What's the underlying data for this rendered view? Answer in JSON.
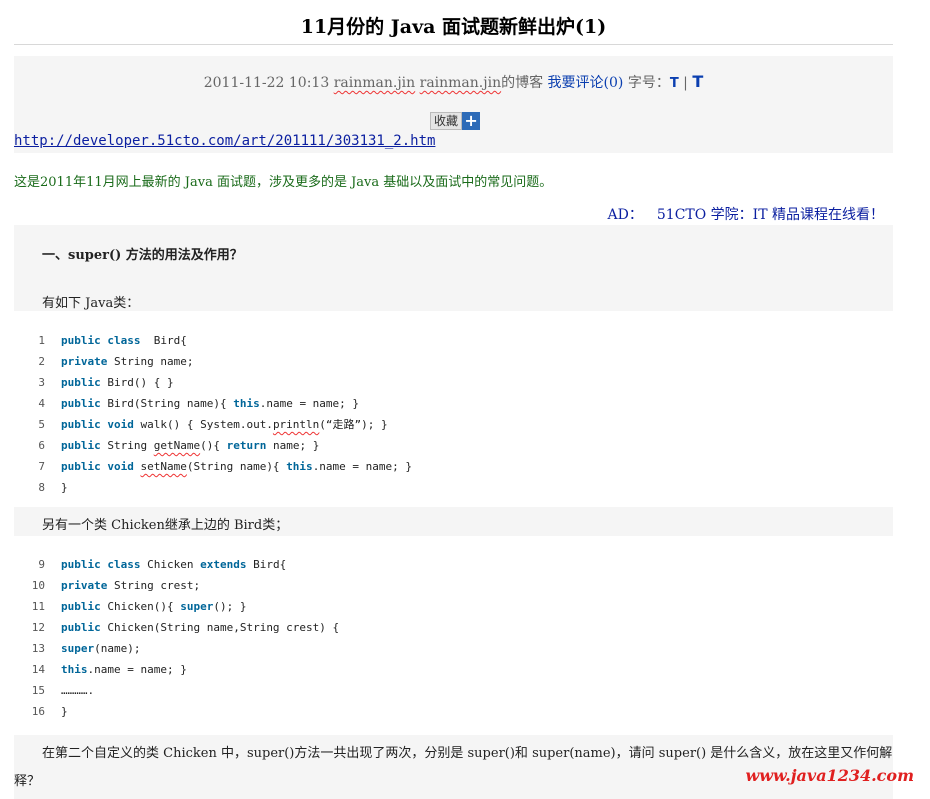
{
  "article": {
    "title": "11月份的 Java 面试题新鲜出炉(1)",
    "date": "2011-11-22 10:13",
    "author1": "rainman.jin",
    "author2": "rainman.jin",
    "blog_suffix": "的博客",
    "comment_link": "我要评论(0)",
    "font_label": "字号：",
    "font_small": "T",
    "font_sep": "|",
    "font_large": "T",
    "collect_label": "收藏",
    "collect_plus": "+",
    "source_url": "http://developer.51cto.com/art/201111/303131_2.htm",
    "intro": "这是2011年11月网上最新的 Java 面试题，涉及更多的是 Java 基础以及面试中的常见问题。",
    "ad_label": "AD：",
    "ad_text": "51CTO 学院：IT 精品课程在线看！",
    "section_heading": "一、super() 方法的用法及作用？",
    "para1": "有如下 Java类：",
    "para2": "另有一个类 Chicken继承上边的 Bird类；",
    "para3": "在第二个自定义的类 Chicken 中，super()方法一共出现了两次，分别是 super()和 super(name)，请问 super() 是什么含义，放在这里又作何解释？",
    "watermark": "www.java1234.com"
  },
  "code1": [
    {
      "n": "1",
      "t": [
        [
          "kw",
          "public class"
        ],
        [
          "",
          "  Bird{"
        ]
      ]
    },
    {
      "n": "2",
      "t": [
        [
          "kw",
          "private"
        ],
        [
          "",
          " String name;"
        ]
      ]
    },
    {
      "n": "3",
      "t": [
        [
          "kw",
          "public"
        ],
        [
          "",
          " Bird() { }"
        ]
      ]
    },
    {
      "n": "4",
      "t": [
        [
          "kw",
          "public"
        ],
        [
          "",
          " Bird(String name){ "
        ],
        [
          "kw",
          "this"
        ],
        [
          "",
          ".name = name; }"
        ]
      ]
    },
    {
      "n": "5",
      "t": [
        [
          "kw",
          "public void"
        ],
        [
          "",
          " walk() { System.out."
        ],
        [
          "wavy",
          "println"
        ],
        [
          "",
          "(“走路”); }"
        ]
      ]
    },
    {
      "n": "6",
      "t": [
        [
          "kw",
          "public"
        ],
        [
          "",
          " String "
        ],
        [
          "wavy",
          "getName"
        ],
        [
          "",
          "(){ "
        ],
        [
          "kw",
          "return"
        ],
        [
          "",
          " name; }"
        ]
      ]
    },
    {
      "n": "7",
      "t": [
        [
          "kw",
          "public void"
        ],
        [
          "",
          " "
        ],
        [
          "wavy",
          "setName"
        ],
        [
          "",
          "(String name){ "
        ],
        [
          "kw",
          "this"
        ],
        [
          "",
          ".name = name; }"
        ]
      ]
    },
    {
      "n": "8",
      "t": [
        [
          "",
          "}"
        ]
      ]
    }
  ],
  "code2": [
    {
      "n": "9",
      "t": [
        [
          "kw",
          "public class"
        ],
        [
          "",
          " Chicken "
        ],
        [
          "kw",
          "extends"
        ],
        [
          "",
          " Bird{"
        ]
      ]
    },
    {
      "n": "10",
      "t": [
        [
          "kw",
          "private"
        ],
        [
          "",
          " String crest;"
        ]
      ]
    },
    {
      "n": "11",
      "t": [
        [
          "kw",
          "public"
        ],
        [
          "",
          " Chicken(){ "
        ],
        [
          "kw",
          "super"
        ],
        [
          "",
          "(); }"
        ]
      ]
    },
    {
      "n": "12",
      "t": [
        [
          "kw",
          "public"
        ],
        [
          "",
          " Chicken(String name,String crest) {"
        ]
      ]
    },
    {
      "n": "13",
      "t": [
        [
          "kw",
          "super"
        ],
        [
          "",
          "(name);"
        ]
      ]
    },
    {
      "n": "14",
      "t": [
        [
          "kw",
          "this"
        ],
        [
          "",
          ".name = name; }"
        ]
      ]
    },
    {
      "n": "15",
      "t": [
        [
          "",
          "…………."
        ]
      ]
    },
    {
      "n": "16",
      "t": [
        [
          "",
          "}"
        ]
      ]
    }
  ]
}
